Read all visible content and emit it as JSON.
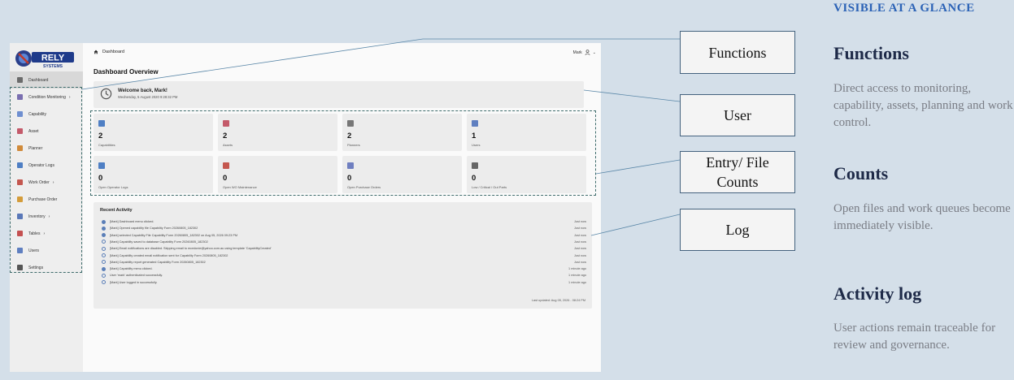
{
  "app": {
    "sidebar": {
      "items": [
        {
          "label": "Dashboard",
          "icon": "home-icon",
          "color": "#6b6b6b",
          "chevron": ""
        },
        {
          "label": "Condition Monitoring",
          "icon": "monitor-icon",
          "color": "#7a6fb0",
          "chevron": "›"
        },
        {
          "label": "Capability",
          "icon": "capability-icon",
          "color": "#6f8fd0",
          "chevron": ""
        },
        {
          "label": "Asset",
          "icon": "asset-icon",
          "color": "#c45a6a",
          "chevron": ""
        },
        {
          "label": "Planner",
          "icon": "calendar-icon",
          "color": "#d08a3a",
          "chevron": ""
        },
        {
          "label": "Operator Logs",
          "icon": "clipboard-icon",
          "color": "#4f7fc4",
          "chevron": ""
        },
        {
          "label": "Work Order",
          "icon": "work-order-icon",
          "color": "#c4574f",
          "chevron": "›"
        },
        {
          "label": "Purchase Order",
          "icon": "purchase-order-icon",
          "color": "#d49c3a",
          "chevron": ""
        },
        {
          "label": "Inventory",
          "icon": "inventory-icon",
          "color": "#5a78b8",
          "chevron": "›"
        },
        {
          "label": "Tables",
          "icon": "table-icon",
          "color": "#c45050",
          "chevron": "›"
        },
        {
          "label": "Users",
          "icon": "users-icon",
          "color": "#5f7fc0",
          "chevron": ""
        },
        {
          "label": "Settings",
          "icon": "settings-icon",
          "color": "#555555",
          "chevron": ""
        }
      ]
    },
    "breadcrumb": "Dashboard",
    "user_name": "Mark",
    "page_title": "Dashboard Overview",
    "welcome": {
      "title": "Welcome back, Mark!",
      "date": "Wednesday, 5 August 2020 9:28:32 PM"
    },
    "cards": [
      {
        "value": "2",
        "label": "Capabilities",
        "icon": "document-icon",
        "color": "#4f7fc4"
      },
      {
        "value": "2",
        "label": "Assets",
        "icon": "factory-icon",
        "color": "#c45a6a"
      },
      {
        "value": "2",
        "label": "Planners",
        "icon": "calendar-icon",
        "color": "#777777"
      },
      {
        "value": "1",
        "label": "Users",
        "icon": "users-icon",
        "color": "#5f7fc0"
      },
      {
        "value": "0",
        "label": "Open Operator Logs",
        "icon": "clipboard-icon",
        "color": "#4f7fc4"
      },
      {
        "value": "0",
        "label": "Open WO Maintenance",
        "icon": "wrench-icon",
        "color": "#c4574f"
      },
      {
        "value": "0",
        "label": "Open Purchase Orders",
        "icon": "document-icon",
        "color": "#6f7fc0"
      },
      {
        "value": "0",
        "label": "Low / Critical / Out Parts",
        "icon": "warning-icon",
        "color": "#666666"
      }
    ],
    "activity": {
      "title": "Recent Activity",
      "rows": [
        {
          "text": "[Mark] Dashboard menu clicked.",
          "time": "Just now",
          "icon": "info-icon"
        },
        {
          "text": "[Mark] Opened capability file Capability Form 20260805_182302",
          "time": "Just now",
          "icon": "folder-icon"
        },
        {
          "text": "[Mark] selected Capability File Capability Form 20260805_182302 on Aug 05, 2026 09:23 PM",
          "time": "Just now",
          "icon": "folder-icon"
        },
        {
          "text": "[Mark] Capability saved to database Capability Form 20260805_182302",
          "time": "Just now",
          "icon": "check-icon"
        },
        {
          "text": "[Mark] Email notifications are disabled. Skipping email to mcedonie@yahoo.com.au using template 'CapabilityCreated'",
          "time": "Just now",
          "icon": "check-icon"
        },
        {
          "text": "[Mark] Capability created email notification sent for Capability Form 20260805_182302",
          "time": "Just now",
          "icon": "check-icon"
        },
        {
          "text": "[Mark] Capability report generated Capability Form 20260805_182302",
          "time": "Just now",
          "icon": "check-icon"
        },
        {
          "text": "[Mark] Capability menu clicked.",
          "time": "1 minute ago",
          "icon": "info-icon"
        },
        {
          "text": "User 'mark' authenticated successfully.",
          "time": "1 minute ago",
          "icon": "check-icon"
        },
        {
          "text": "[Mark] User logged in successfully.",
          "time": "1 minute ago",
          "icon": "check-icon"
        }
      ],
      "last_updated": "Last updated: Aug 05, 2026 - 08:24 PM"
    }
  },
  "callouts": {
    "functions": "Functions",
    "user": "User",
    "entry": "Entry/ File Counts",
    "log": "Log"
  },
  "right_panel": {
    "kicker": "VISIBLE AT A GLANCE",
    "sections": [
      {
        "heading": "Functions",
        "body": "Direct access to monitoring, capability, assets, planning and work control."
      },
      {
        "heading": "Counts",
        "body": "Open files and work queues become immediately visible."
      },
      {
        "heading": "Activity log",
        "body": "User actions remain traceable for review and governance."
      }
    ]
  },
  "colors": {
    "background": "#d4dfe9",
    "heading": "#1e2a48",
    "kicker": "#2c63b6",
    "body_text": "#7a7d85",
    "annotation": "#3d6b6b"
  }
}
